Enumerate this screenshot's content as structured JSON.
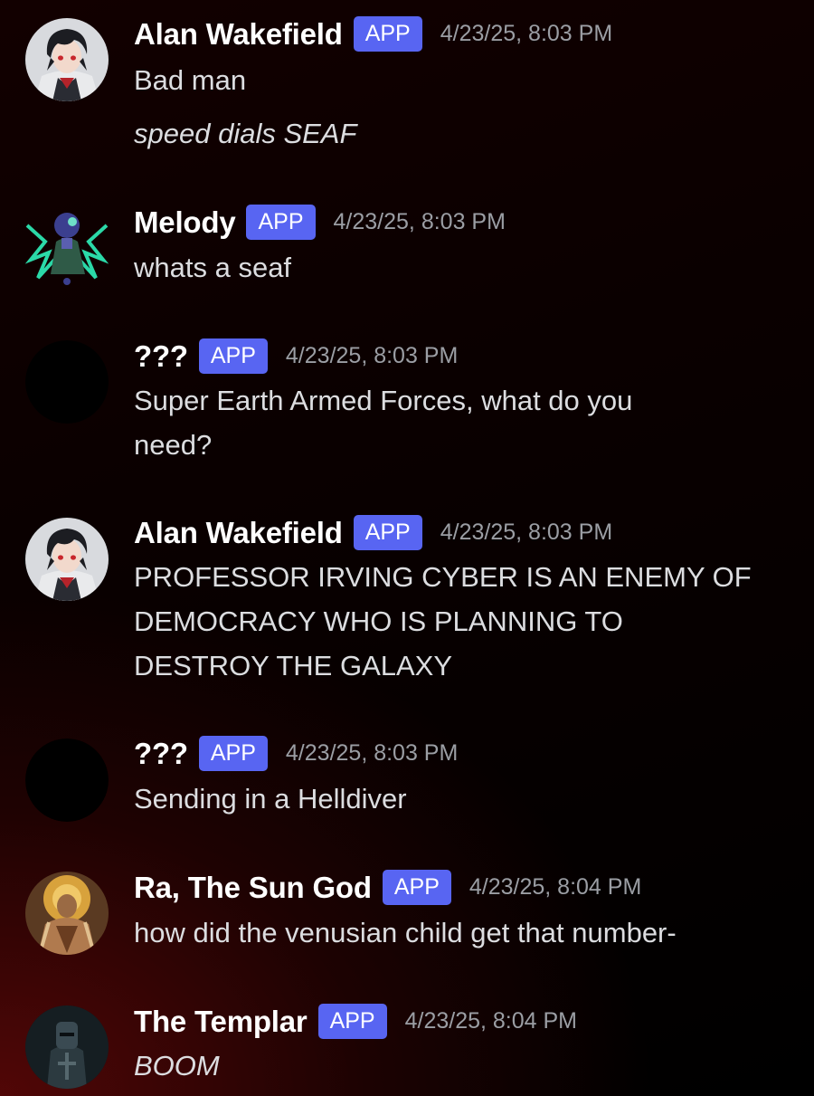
{
  "messages": [
    {
      "username": "Alan Wakefield",
      "badge": "APP",
      "timestamp": "4/23/25, 8:03 PM",
      "lines": [
        "Bad man"
      ],
      "followup": "speed dials SEAF"
    },
    {
      "username": "Melody",
      "badge": "APP",
      "timestamp": "4/23/25, 8:03 PM",
      "lines": [
        "whats a seaf"
      ]
    },
    {
      "username": "???",
      "badge": "APP",
      "timestamp": "4/23/25, 8:03 PM",
      "lines": [
        "Super Earth Armed Forces, what do you",
        "need?"
      ]
    },
    {
      "username": "Alan Wakefield",
      "badge": "APP",
      "timestamp": "4/23/25, 8:03 PM",
      "lines": [
        "PROFESSOR IRVING CYBER IS AN ENEMY OF",
        "DEMOCRACY WHO IS PLANNING TO",
        "DESTROY THE GALAXY"
      ]
    },
    {
      "username": "???",
      "badge": "APP",
      "timestamp": "4/23/25, 8:03 PM",
      "lines": [
        "Sending in a Helldiver"
      ]
    },
    {
      "username": "Ra, The Sun God",
      "badge": "APP",
      "timestamp": "4/23/25, 8:04 PM",
      "lines": [
        "how did the venusian child get that number-"
      ]
    },
    {
      "username": "The Templar",
      "badge": "APP",
      "timestamp": "4/23/25, 8:04 PM",
      "lines": [
        "BOOM"
      ]
    }
  ],
  "colors": {
    "badge_bg": "#5865f2",
    "username": "#ffffff",
    "timestamp": "#9b9ea4",
    "message_text": "#dcdde0"
  },
  "icons": {
    "avatar_alan": "anime-avatar-dark-hair",
    "avatar_melody": "robot-avatar-green",
    "avatar_unknown": "black-circle-avatar",
    "avatar_ra": "ra-sun-god-avatar",
    "avatar_templar": "templar-armor-avatar"
  }
}
